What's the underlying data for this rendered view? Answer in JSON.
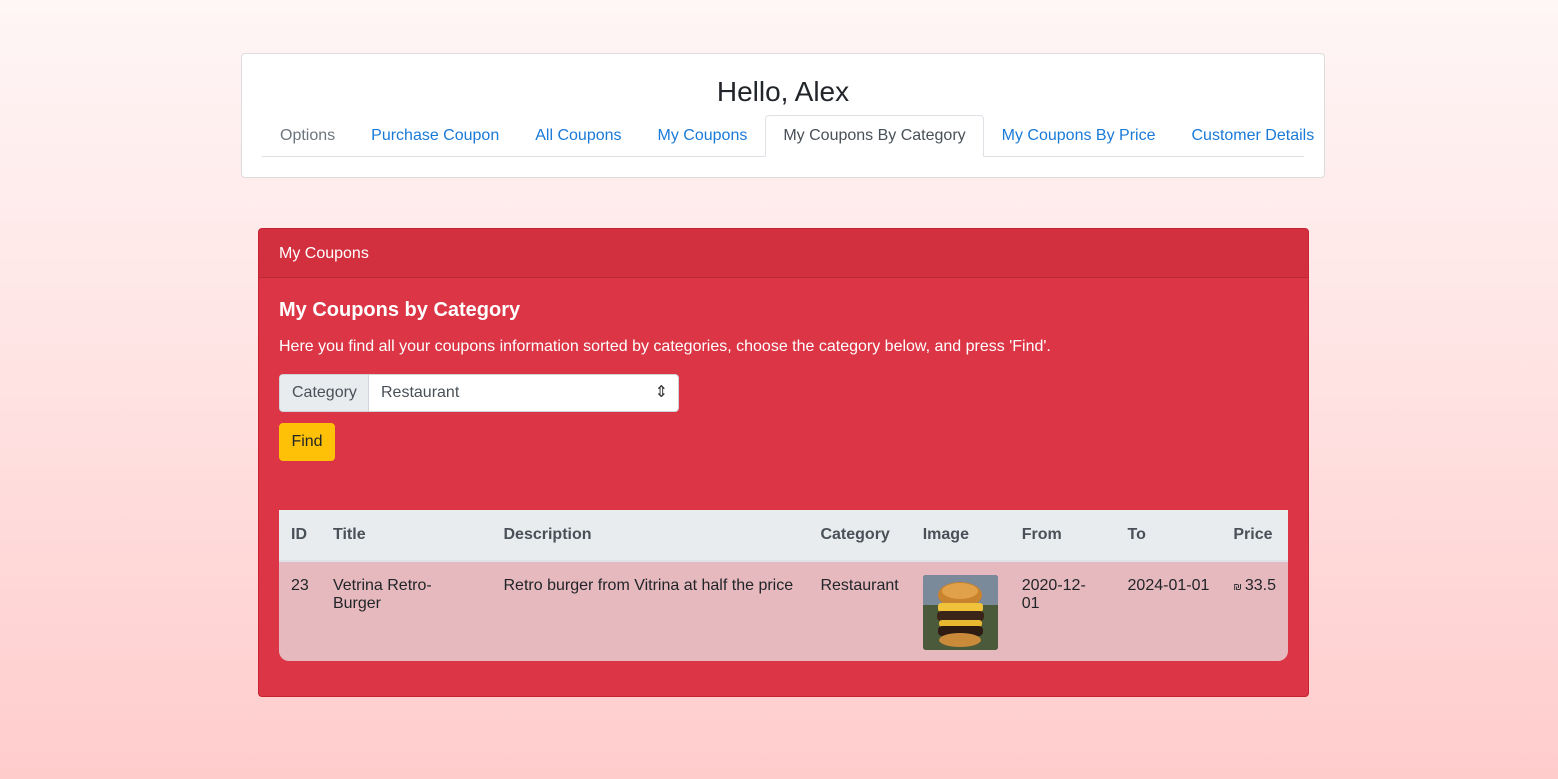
{
  "header": {
    "greeting": "Hello, Alex",
    "tabs": [
      {
        "label": "Options"
      },
      {
        "label": "Purchase Coupon"
      },
      {
        "label": "All Coupons"
      },
      {
        "label": "My Coupons"
      },
      {
        "label": "My Coupons By Category"
      },
      {
        "label": "My Coupons By Price"
      },
      {
        "label": "Customer Details"
      }
    ],
    "active_tab": "My Coupons By Category"
  },
  "panel": {
    "header": "My Coupons",
    "title": "My Coupons by Category",
    "description": "Here you find all your coupons information sorted by categories, choose the category below, and press 'Find'.",
    "category_label": "Category",
    "category_value": "Restaurant",
    "find_label": "Find",
    "table": {
      "columns": [
        "ID",
        "Title",
        "Description",
        "Category",
        "Image",
        "From",
        "To",
        "Price"
      ],
      "rows": [
        {
          "id": "23",
          "title": "Vetrina Retro-Burger",
          "description": "Retro burger from Vitrina at half the price",
          "category": "Restaurant",
          "image": "burger-image",
          "from": "2020-12-01",
          "to": "2024-01-01",
          "currency": "₪",
          "price": "33.5"
        }
      ]
    }
  },
  "colors": {
    "panel": "#dc3545",
    "find_button": "#ffc107",
    "link": "#1a7ad8",
    "row": "#e6b9be"
  }
}
